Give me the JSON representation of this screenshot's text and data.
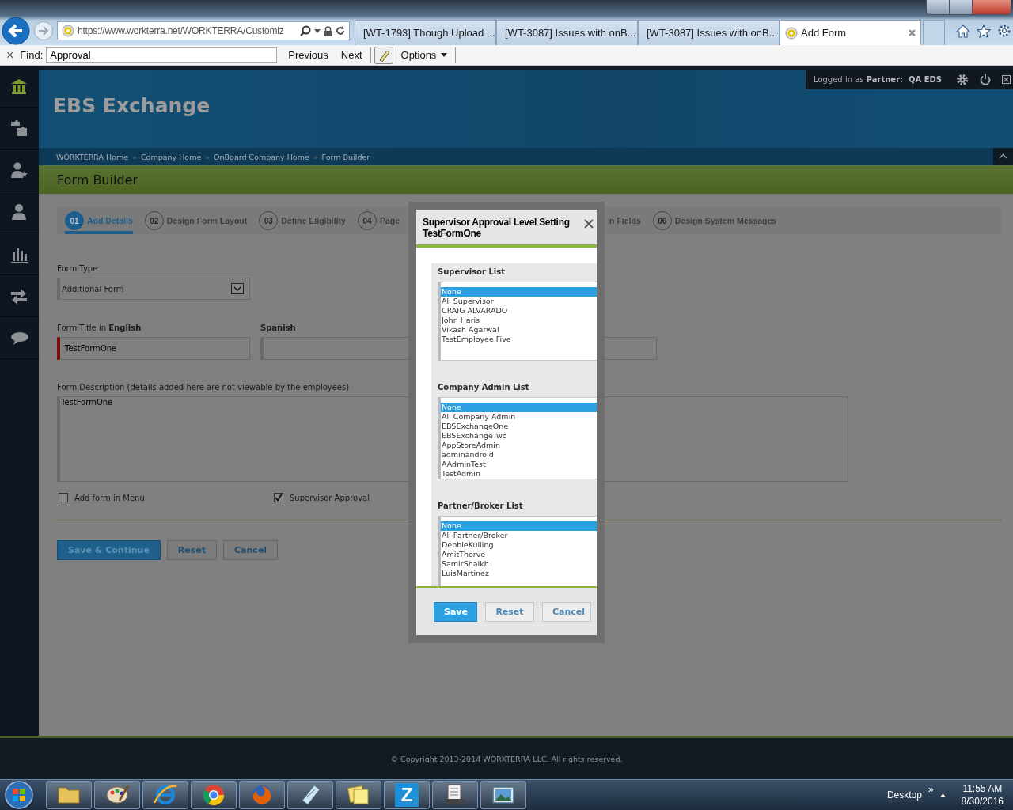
{
  "browser": {
    "address": "https://www.workterra.net/WORKTERRA/Customiz",
    "tabs": [
      {
        "kind": "jira",
        "title": "[WT-1793] Though Upload ...",
        "selected": false
      },
      {
        "kind": "ie",
        "title": "[WT-3087] Issues with onB...",
        "selected": false
      },
      {
        "kind": "jira",
        "title": "[WT-3087] Issues with onB...",
        "selected": false
      },
      {
        "kind": "site",
        "title": "Add Form",
        "selected": true
      }
    ]
  },
  "find_bar": {
    "close": "×",
    "label": "Find:",
    "value": "Approval",
    "previous": "Previous",
    "next": "Next",
    "options": "Options"
  },
  "sidebar": {
    "items": [
      {
        "kind": "home",
        "selected": true
      },
      {
        "kind": "puzzle",
        "selected": false
      },
      {
        "kind": "user-star",
        "selected": false
      },
      {
        "kind": "user",
        "selected": false
      },
      {
        "kind": "chart",
        "selected": false
      },
      {
        "kind": "arrows",
        "selected": false
      },
      {
        "kind": "chat",
        "selected": false
      }
    ]
  },
  "header": {
    "title": "EBS Exchange",
    "login": "Logged in as **Partner:  QA EDS**"
  },
  "breadcrumbs": {
    "separator": "»",
    "items": [
      "WORKTERRA Home",
      "Company Home",
      "OnBoard Company Home",
      "Form Builder"
    ]
  },
  "page_title": "Form Builder",
  "steps": [
    {
      "number": "01",
      "label": "Add Details",
      "selected": true
    },
    {
      "number": "02",
      "label": "Design Form Layout",
      "selected": false
    },
    {
      "number": "03",
      "label": "Define Eligibility",
      "selected": false
    },
    {
      "number": "04",
      "label": "Page",
      "selected": false
    },
    {
      "label": "n Fields",
      "selected": false
    },
    {
      "number": "06",
      "label": "Design System Messages",
      "selected": false
    }
  ],
  "form": {
    "form_type": {
      "label": "Form Type",
      "value": "Additional Form"
    },
    "title_english": {
      "label": "Form Title in **English**",
      "value": "TestFormOne"
    },
    "title_spanish": {
      "label": "Spanish"
    },
    "description": {
      "label": "Form Description (details added here are not viewable by the employees)",
      "value": "TestFormOne"
    },
    "checkboxes": [
      {
        "label": "Add form in Menu",
        "checked": false
      },
      {
        "label": "Supervisor Approval",
        "checked": true
      }
    ],
    "buttons": [
      {
        "kind": "primary",
        "label": "Save & Continue"
      },
      {
        "kind": "secondary",
        "label": "Reset"
      },
      {
        "kind": "secondary",
        "label": "Cancel"
      }
    ]
  },
  "modal": {
    "title": "Supervisor Approval Level Setting TestFormOne",
    "lists": [
      {
        "label": "Supervisor List",
        "items": [
          {
            "text": "None",
            "selected": true
          },
          {
            "text": "All Supervisor",
            "selected": false
          },
          {
            "text": "CRAIG ALVARADO",
            "selected": false
          },
          {
            "text": "John Haris",
            "selected": false
          },
          {
            "text": "Vikash Agarwal",
            "selected": false
          },
          {
            "text": "TestEmployee Five",
            "selected": false
          }
        ]
      },
      {
        "label": "Company Admin List",
        "items": [
          {
            "text": "None",
            "selected": true
          },
          {
            "text": "All Company Admin",
            "selected": false
          },
          {
            "text": "EBSExchangeOne",
            "selected": false
          },
          {
            "text": "EBSExchangeTwo",
            "selected": false
          },
          {
            "text": "AppStoreAdmin",
            "selected": false
          },
          {
            "text": "adminandroid",
            "selected": false
          },
          {
            "text": "AAdminTest",
            "selected": false
          },
          {
            "text": "TestAdmin",
            "selected": false
          }
        ]
      },
      {
        "label": "Partner/Broker List",
        "items": [
          {
            "text": "None",
            "selected": true
          },
          {
            "text": "All Partner/Broker",
            "selected": false
          },
          {
            "text": "DebbieKulling",
            "selected": false
          },
          {
            "text": "AmitThorve",
            "selected": false
          },
          {
            "text": "SamirShaikh",
            "selected": false
          },
          {
            "text": "LuisMartinez",
            "selected": false
          }
        ]
      }
    ],
    "buttons": [
      {
        "kind": "primary",
        "label": "Save"
      },
      {
        "kind": "secondary",
        "label": "Reset"
      },
      {
        "kind": "secondary",
        "label": "Cancel"
      }
    ]
  },
  "footer": {
    "copyright": "© Copyright 2013-2014 WORKTERRA LLC. All rights reserved."
  },
  "taskbar": {
    "apps": [
      {
        "kind": "folder"
      },
      {
        "kind": "paint"
      },
      {
        "kind": "ie"
      },
      {
        "kind": "chrome"
      },
      {
        "kind": "firefox"
      },
      {
        "kind": "notepad"
      },
      {
        "kind": "notes"
      },
      {
        "kind": "letter",
        "label": "Z"
      },
      {
        "kind": "scanner"
      },
      {
        "kind": "picture"
      }
    ],
    "desktop": "Desktop",
    "chevron": "»",
    "time": "11:55 AM",
    "date": "8/30/2016"
  }
}
